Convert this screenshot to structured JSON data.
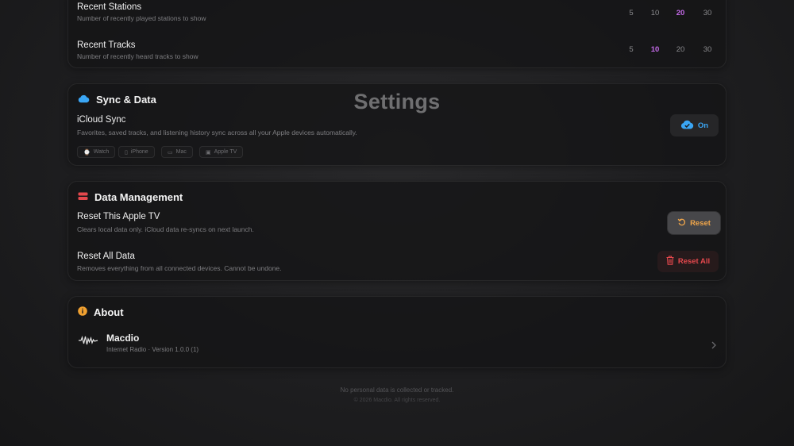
{
  "page_title": "Settings",
  "history": {
    "recent_stations": {
      "title": "Recent Stations",
      "subtitle": "Number of recently played stations to show",
      "options": [
        "5",
        "10",
        "20",
        "30"
      ],
      "selected": "20"
    },
    "recent_tracks": {
      "title": "Recent Tracks",
      "subtitle": "Number of recently heard tracks to show",
      "options": [
        "5",
        "10",
        "20",
        "30"
      ],
      "selected": "10"
    }
  },
  "sync": {
    "title": "Sync & Data",
    "icon": "cloud-icon",
    "icloud_title": "iCloud Sync",
    "icloud_subtitle": "Favorites, saved tracks, and listening history sync across all your Apple devices automatically.",
    "toggle_label": "On",
    "devices": [
      "Watch",
      "iPhone",
      "Mac",
      "Apple TV"
    ]
  },
  "data_management": {
    "title": "Data Management",
    "reset_tv_title": "Reset This Apple TV",
    "reset_tv_subtitle": "Clears local data only. iCloud data re-syncs on next launch.",
    "reset_label": "Reset",
    "reset_all_title": "Reset All Data",
    "reset_all_subtitle": "Removes everything from all connected devices. Cannot be undone.",
    "reset_all_label": "Reset All"
  },
  "about": {
    "title": "About",
    "app_name": "Macdio",
    "app_subtitle": "Internet Radio · Version 1.0.0 (1)"
  },
  "footer": {
    "line1": "No personal data is collected or tracked.",
    "line2": "© 2026 Macdio. All rights reserved."
  },
  "colors": {
    "accent_purple": "#c46ae8",
    "icloud_blue": "#3aa6f5",
    "reset_orange": "#f0a64a",
    "danger_red": "#e5484d",
    "info_orange": "#f0a030"
  }
}
